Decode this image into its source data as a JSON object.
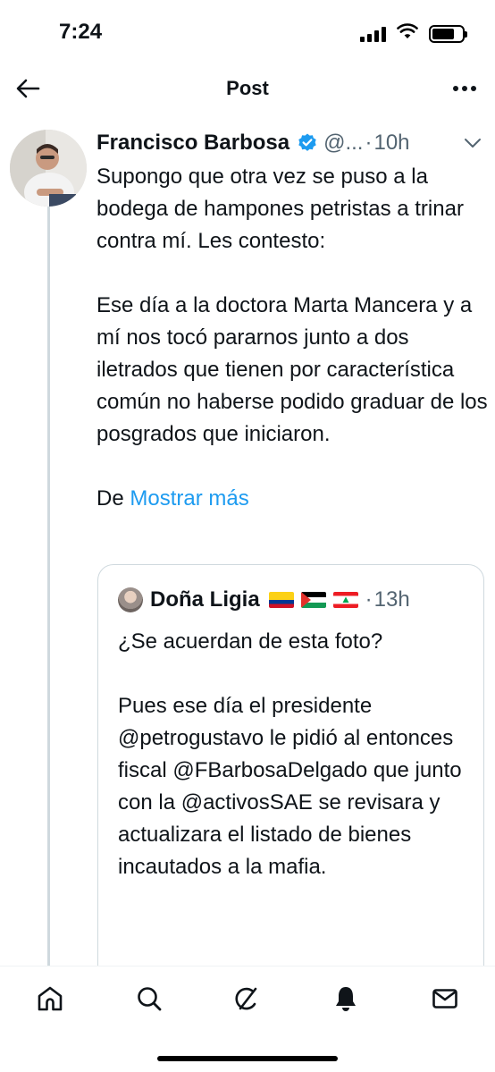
{
  "status_bar": {
    "time": "7:24"
  },
  "header": {
    "title": "Post"
  },
  "post": {
    "author_name": "Francisco Barbosa",
    "handle": "@...",
    "separator": "·",
    "time_ago": "10h",
    "paragraphs": [
      "Supongo que otra vez se puso a la bodega de hampones petristas a trinar contra mí. Les contesto:",
      "Ese día a la doctora Marta Mancera y a mí nos tocó pararnos junto a dos iletrados que tienen por característica común no haberse podido graduar de los posgrados que iniciaron."
    ],
    "truncated_start": "De ",
    "show_more": "Mostrar más"
  },
  "quote": {
    "author_name": "Doña Ligia",
    "separator": "·",
    "time_ago": "13h",
    "flags": [
      "colombia-flag",
      "palestine-flag",
      "lebanon-flag"
    ],
    "paragraphs": [
      "¿Se acuerdan de esta foto?",
      "Pues ese día el presidente @petrogustavo le pidió al entonces fiscal @FBarbosaDelgado que junto con la @activosSAE se revisara y actualizara el listado de bienes incautados a la mafia."
    ]
  },
  "tabs": [
    "home-icon",
    "search-icon",
    "grok-icon",
    "notifications-icon",
    "messages-icon"
  ],
  "colors": {
    "link": "#1d9bf0",
    "secondary_text": "#536471",
    "verified": "#1d9bf0",
    "border": "#cfd9de"
  }
}
